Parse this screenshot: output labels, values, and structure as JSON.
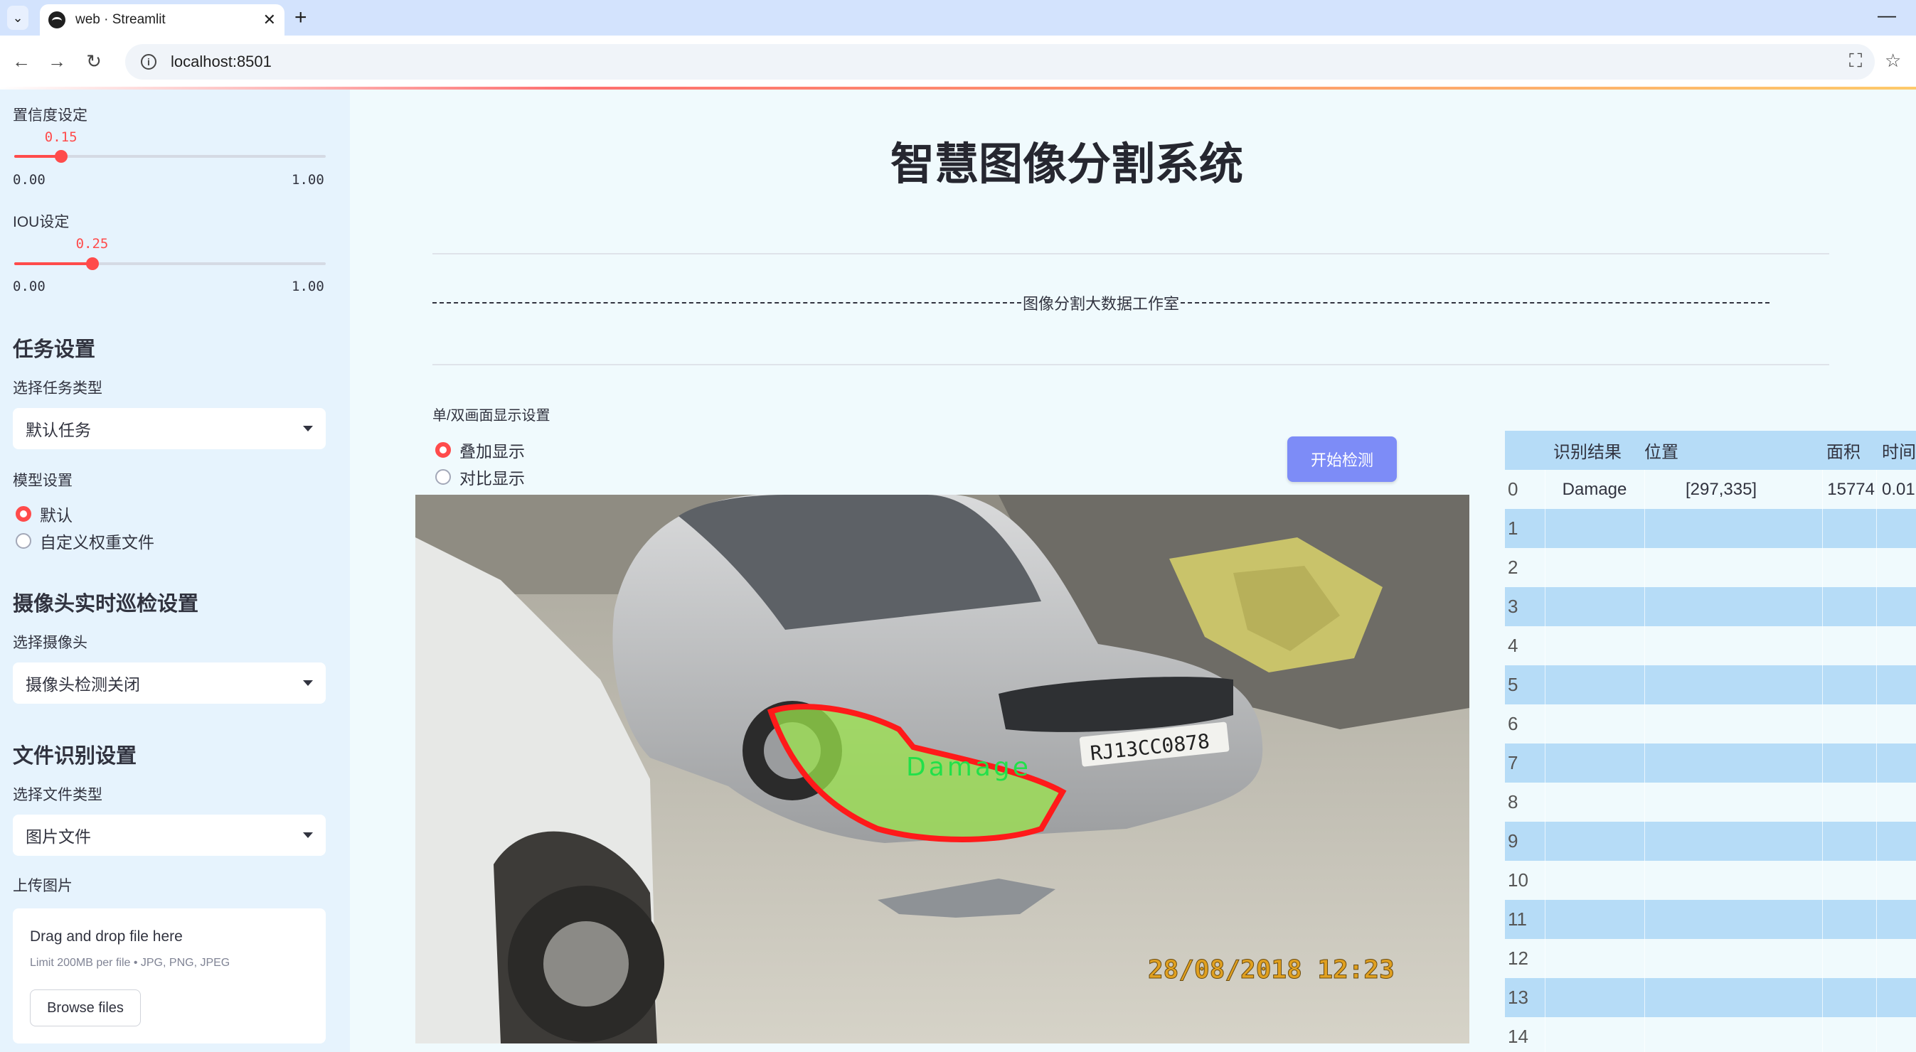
{
  "browser": {
    "tab_title": "web · Streamlit",
    "url": "localhost:8501"
  },
  "sidebar": {
    "confidence": {
      "label": "置信度设定",
      "value": "0.15",
      "min": "0.00",
      "max": "1.00",
      "fraction": 0.15
    },
    "iou": {
      "label": "IOU设定",
      "value": "0.25",
      "min": "0.00",
      "max": "1.00",
      "fraction": 0.25
    },
    "task_header": "任务设置",
    "task_type_label": "选择任务类型",
    "task_type_value": "默认任务",
    "model_label": "模型设置",
    "model_options": [
      "默认",
      "自定义权重文件"
    ],
    "camera_header": "摄像头实时巡检设置",
    "camera_label": "选择摄像头",
    "camera_value": "摄像头检测关闭",
    "file_header": "文件识别设置",
    "file_type_label": "选择文件类型",
    "file_type_value": "图片文件",
    "upload_label": "上传图片",
    "upload_title": "Drag and drop file here",
    "upload_limit": "Limit 200MB per file • JPG, PNG, JPEG",
    "browse_label": "Browse files"
  },
  "main": {
    "title": "智慧图像分割系统",
    "studio_text": "图像分割大数据工作室",
    "display_mode_label": "单/双画面显示设置",
    "display_modes": [
      "叠加显示",
      "对比显示"
    ],
    "start_button": "开始检测",
    "image": {
      "plate": "RJ13CC0878",
      "detection_label": "Damage",
      "timestamp": "28/08/2018  12:23"
    }
  },
  "results_table": {
    "headers": [
      "识别结果",
      "位置",
      "面积",
      "时间"
    ],
    "rows": [
      {
        "index": "0",
        "result": "Damage",
        "position": "[297,335]",
        "area": "15774",
        "time": "0.01"
      },
      {
        "index": "1",
        "result": "",
        "position": "",
        "area": "",
        "time": ""
      },
      {
        "index": "2",
        "result": "",
        "position": "",
        "area": "",
        "time": ""
      },
      {
        "index": "3",
        "result": "",
        "position": "",
        "area": "",
        "time": ""
      },
      {
        "index": "4",
        "result": "",
        "position": "",
        "area": "",
        "time": ""
      },
      {
        "index": "5",
        "result": "",
        "position": "",
        "area": "",
        "time": ""
      },
      {
        "index": "6",
        "result": "",
        "position": "",
        "area": "",
        "time": ""
      },
      {
        "index": "7",
        "result": "",
        "position": "",
        "area": "",
        "time": ""
      },
      {
        "index": "8",
        "result": "",
        "position": "",
        "area": "",
        "time": ""
      },
      {
        "index": "9",
        "result": "",
        "position": "",
        "area": "",
        "time": ""
      },
      {
        "index": "10",
        "result": "",
        "position": "",
        "area": "",
        "time": ""
      },
      {
        "index": "11",
        "result": "",
        "position": "",
        "area": "",
        "time": ""
      },
      {
        "index": "12",
        "result": "",
        "position": "",
        "area": "",
        "time": ""
      },
      {
        "index": "13",
        "result": "",
        "position": "",
        "area": "",
        "time": ""
      },
      {
        "index": "14",
        "result": "",
        "position": "",
        "area": "",
        "time": ""
      }
    ]
  },
  "colors": {
    "accent": "#ff4b4b",
    "sidebar_bg": "#e6f3fd",
    "page_bg": "#f0fafd",
    "button": "#7d8cf7",
    "table_stripe": "#b6dcf7",
    "mask_outline": "#ff1a1a",
    "mask_fill": "#9be34c"
  }
}
